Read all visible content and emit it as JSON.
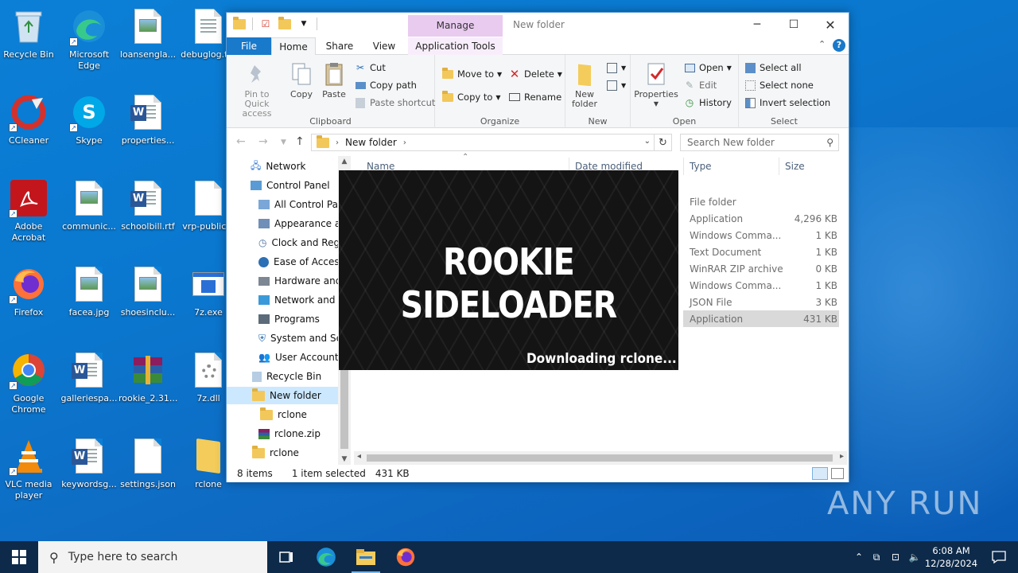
{
  "desktop": {
    "icons": [
      {
        "label": "Recycle Bin"
      },
      {
        "label": "Microsoft Edge"
      },
      {
        "label": "loansengla..."
      },
      {
        "label": "debuglog.t..."
      },
      {
        "label": "CCleaner"
      },
      {
        "label": "Skype"
      },
      {
        "label": "properties..."
      },
      {
        "label": "Adobe Acrobat"
      },
      {
        "label": "communic..."
      },
      {
        "label": "schoolbill.rtf"
      },
      {
        "label": "vrp-public..."
      },
      {
        "label": "Firefox"
      },
      {
        "label": "facea.jpg"
      },
      {
        "label": "shoesinclu..."
      },
      {
        "label": "7z.exe"
      },
      {
        "label": "Google Chrome"
      },
      {
        "label": "galleriespa..."
      },
      {
        "label": "rookie_2.31..."
      },
      {
        "label": "7z.dll"
      },
      {
        "label": "VLC media player"
      },
      {
        "label": "keywordsg..."
      },
      {
        "label": "settings.json"
      },
      {
        "label": "rclone"
      }
    ],
    "watermark": "ANY RUN"
  },
  "explorer": {
    "title": "New folder",
    "manage_tab": "Manage",
    "tabs": {
      "file": "File",
      "home": "Home",
      "share": "Share",
      "view": "View",
      "app_tools": "Application Tools"
    },
    "ribbon": {
      "clipboard": {
        "title": "Clipboard",
        "pin": "Pin to Quick access",
        "copy": "Copy",
        "paste": "Paste",
        "cut": "Cut",
        "copy_path": "Copy path",
        "paste_shortcut": "Paste shortcut"
      },
      "organize": {
        "title": "Organize",
        "move_to": "Move to",
        "copy_to": "Copy to",
        "delete": "Delete",
        "rename": "Rename"
      },
      "new": {
        "title": "New",
        "new_folder": "New folder"
      },
      "open": {
        "title": "Open",
        "properties": "Properties",
        "open": "Open",
        "edit": "Edit",
        "history": "History"
      },
      "select": {
        "title": "Select",
        "select_all": "Select all",
        "select_none": "Select none",
        "invert": "Invert selection"
      }
    },
    "address": {
      "path": "New folder",
      "search_placeholder": "Search New folder"
    },
    "nav_items": [
      "Network",
      "Control Panel",
      "All Control Par",
      "Appearance an",
      "Clock and Regi",
      "Ease of Access",
      "Hardware and",
      "Network and Ir",
      "Programs",
      "System and Se",
      "User Accounts",
      "Recycle Bin",
      "New folder",
      "rclone",
      "rclone.zip",
      "rclone"
    ],
    "columns": {
      "name": "Name",
      "date": "Date modified",
      "type": "Type",
      "size": "Size"
    },
    "rows": [
      {
        "type": "File folder",
        "size": ""
      },
      {
        "type": "Application",
        "size": "4,296 KB"
      },
      {
        "type": "Windows Comma...",
        "size": "1 KB"
      },
      {
        "type": "Text Document",
        "size": "1 KB"
      },
      {
        "type": "WinRAR ZIP archive",
        "size": "0 KB"
      },
      {
        "type": "Windows Comma...",
        "size": "1 KB"
      },
      {
        "type": "JSON File",
        "size": "3 KB"
      },
      {
        "type": "Application",
        "size": "431 KB"
      }
    ],
    "status": {
      "items": "8 items",
      "selected": "1 item selected",
      "size": "431 KB"
    }
  },
  "splash": {
    "title": "ROOKIE SIDELOADER",
    "status": "Downloading rclone..."
  },
  "taskbar": {
    "search_placeholder": "Type here to search",
    "time": "6:08 AM",
    "date": "12/28/2024"
  }
}
